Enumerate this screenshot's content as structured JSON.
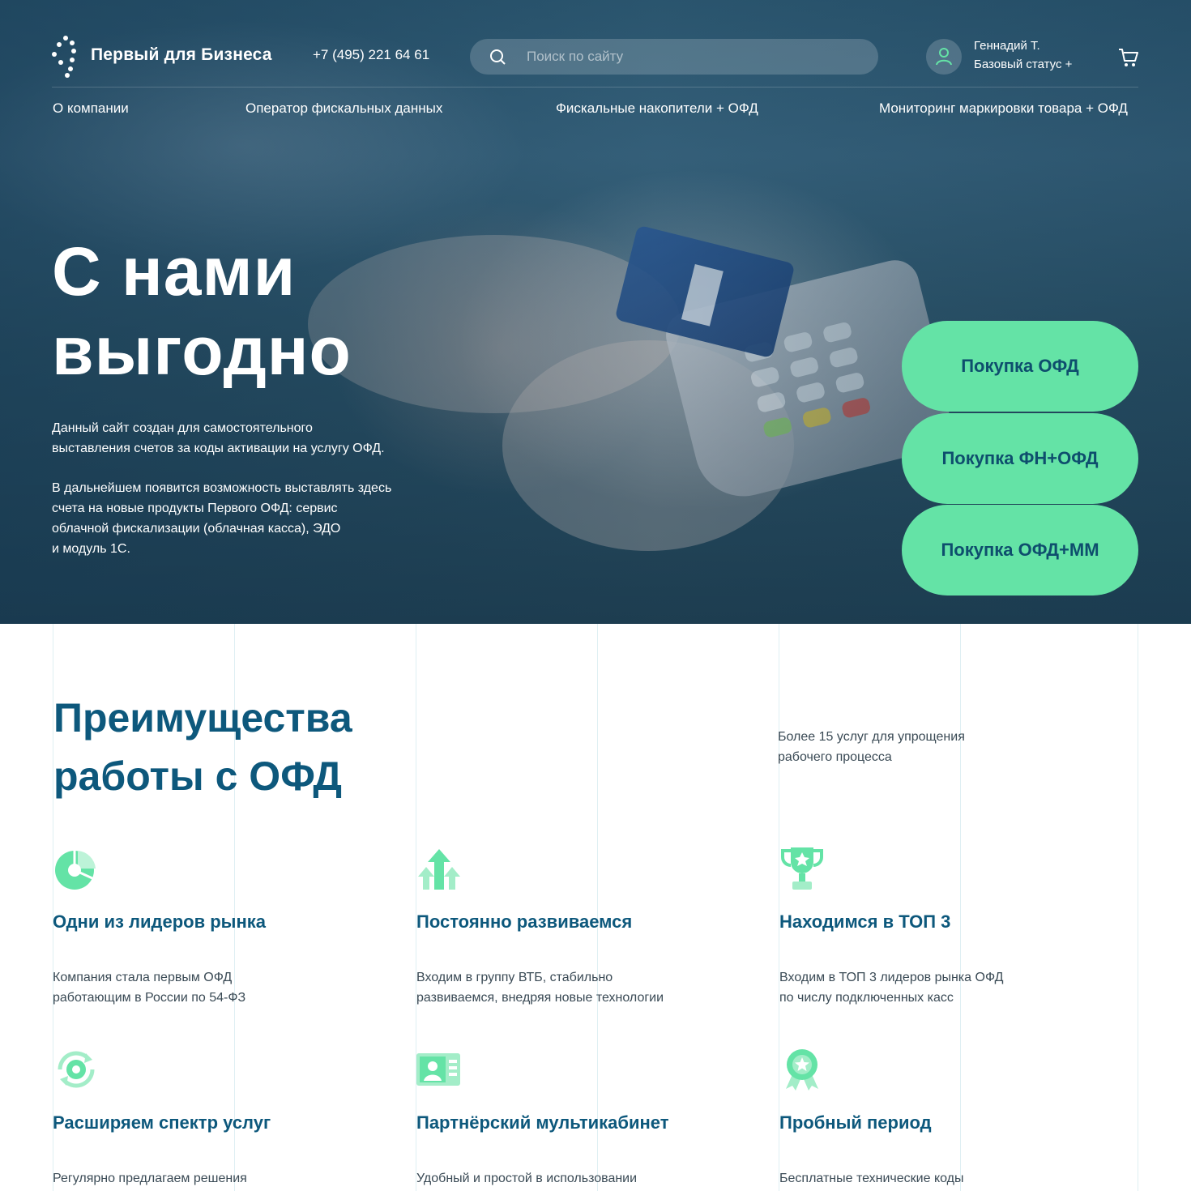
{
  "header": {
    "brand": "Первый для Бизнеса",
    "phone": "+7 (495) 221 64 61",
    "search_placeholder": "Поиск по сайту",
    "user_name": "Геннадий Т.",
    "user_status": "Базовый статус +"
  },
  "nav": {
    "items": [
      {
        "label": "О компании"
      },
      {
        "label": "Оператор фискальных данных"
      },
      {
        "label": "Фискальные накопители + ОФД"
      },
      {
        "label": "Мониторинг маркировки товара + ОФД"
      }
    ]
  },
  "hero": {
    "title_line1": "С нами",
    "title_line2": "выгодно",
    "p1_line1": "Данный сайт создан для самостоятельного",
    "p1_line2": "выставления счетов за коды активации на услугу ОФД.",
    "p2_line1": "В дальнейшем появится возможность выставлять здесь",
    "p2_line2": "счета на новые продукты Первого ОФД: сервис",
    "p2_line3": "облачной фискализации (облачная касса), ЭДО",
    "p2_line4": "и модуль 1С.",
    "buttons": [
      {
        "label": "Покупка ОФД"
      },
      {
        "label": "Покупка ФН+ОФД"
      },
      {
        "label": "Покупка ОФД+ММ"
      }
    ]
  },
  "advantages": {
    "title_line1": "Преимущества",
    "title_line2": "работы с ОФД",
    "aside_line1": "Более 15 услуг для упрощения",
    "aside_line2": "рабочего процесса",
    "items": [
      {
        "icon": "pie-chart-icon",
        "title": "Одни из лидеров рынка",
        "text_line1": "Компания стала первым ОФД",
        "text_line2": "работающим в России по 54-ФЗ"
      },
      {
        "icon": "arrows-up-icon",
        "title": "Постоянно развиваемся",
        "text_line1": "Входим в группу ВТБ, стабильно",
        "text_line2": "развиваемся, внедряя новые технологии"
      },
      {
        "icon": "trophy-icon",
        "title": "Находимся в ТОП 3",
        "text_line1": "Входим в ТОП 3 лидеров рынка ОФД",
        "text_line2": "по числу подключенных касс"
      },
      {
        "icon": "gear-refresh-icon",
        "title": "Расширяем спектр услуг",
        "text_line1": "Регулярно предлагаем решения",
        "text_line2": ""
      },
      {
        "icon": "id-card-icon",
        "title": "Партнёрский мультикабинет",
        "text_line1": "Удобный и простой в использовании",
        "text_line2": ""
      },
      {
        "icon": "badge-star-icon",
        "title": "Пробный период",
        "text_line1": "Бесплатные технические коды",
        "text_line2": ""
      }
    ]
  },
  "colors": {
    "accent": "#64e3a6",
    "heading": "#0d587c",
    "hero_bg": "#2c5367"
  }
}
